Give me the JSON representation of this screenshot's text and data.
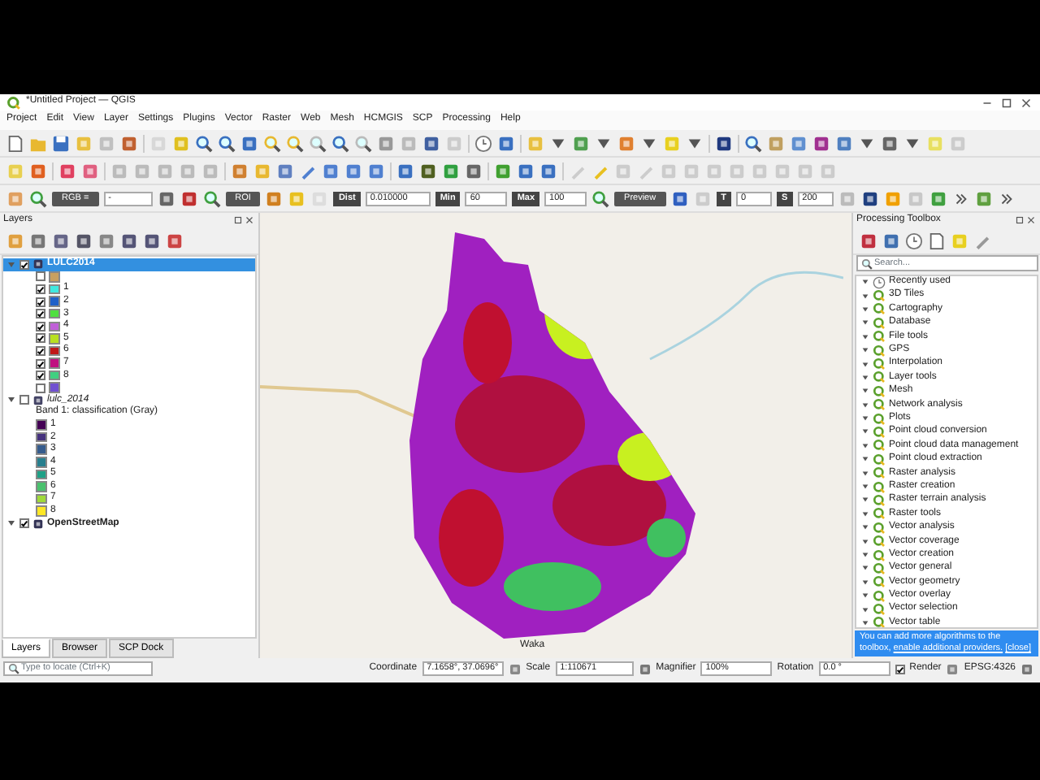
{
  "window": {
    "title": "*Untitled Project — QGIS"
  },
  "menu": [
    "Project",
    "Edit",
    "View",
    "Layer",
    "Settings",
    "Plugins",
    "Vector",
    "Raster",
    "Web",
    "Mesh",
    "HCMGIS",
    "SCP",
    "Processing",
    "Help"
  ],
  "scp_toolbar": {
    "rgb_label": "RGB =",
    "band_value": "-",
    "roi_label": "ROI",
    "fields": [
      {
        "label": "Dist",
        "value": "0.010000"
      },
      {
        "label": "Min",
        "value": "60"
      },
      {
        "label": "Max",
        "value": "100"
      }
    ],
    "preview_label": "Preview",
    "fields_2": [
      {
        "label": "T",
        "value": "0"
      },
      {
        "label": "S",
        "value": "200"
      }
    ]
  },
  "layers_panel": {
    "title": "Layers",
    "layers": [
      {
        "name": "LULC2014",
        "italic": false,
        "checked": true,
        "selected": true,
        "legend": [
          {
            "color": "#c8a060",
            "checked": false
          },
          {
            "label": "1",
            "color": "#40e8e0",
            "checked": true
          },
          {
            "label": "2",
            "color": "#2060c8",
            "checked": true
          },
          {
            "label": "3",
            "color": "#50e040",
            "checked": true
          },
          {
            "label": "4",
            "color": "#c060d8",
            "checked": true
          },
          {
            "label": "5",
            "color": "#b8e020",
            "checked": true
          },
          {
            "label": "6",
            "color": "#c01818",
            "checked": true
          },
          {
            "label": "7",
            "color": "#c01080",
            "checked": true
          },
          {
            "label": "8",
            "color": "#40d080",
            "checked": true
          },
          {
            "color": "#7050d0",
            "checked": false
          }
        ]
      },
      {
        "name": "lulc_2014",
        "italic": true,
        "checked": false,
        "selected": false,
        "subtitle": "Band 1: classification (Gray)",
        "legend": [
          {
            "label": "1",
            "color": "#440154"
          },
          {
            "label": "2",
            "color": "#46327e"
          },
          {
            "label": "3",
            "color": "#365c8d"
          },
          {
            "label": "4",
            "color": "#277f8e"
          },
          {
            "label": "5",
            "color": "#1fa187"
          },
          {
            "label": "6",
            "color": "#4ac16d"
          },
          {
            "label": "7",
            "color": "#a0da39"
          },
          {
            "label": "8",
            "color": "#fde725"
          }
        ]
      },
      {
        "name": "OpenStreetMap",
        "italic": false,
        "checked": true,
        "selected": false
      }
    ],
    "tabs": [
      {
        "label": "Layers",
        "selected": true
      },
      {
        "label": "Browser",
        "selected": false
      },
      {
        "label": "SCP Dock",
        "selected": false
      }
    ],
    "locate": {
      "placeholder": "Type to locate (Ctrl+K)"
    }
  },
  "map": {
    "place_label": "Waka"
  },
  "processing_toolbox": {
    "title": "Processing Toolbox",
    "search": {
      "placeholder": "Search..."
    },
    "items": [
      {
        "label": "Recently used",
        "kind": "recent"
      },
      {
        "label": "3D Tiles",
        "kind": "provider"
      },
      {
        "label": "Cartography",
        "kind": "provider"
      },
      {
        "label": "Database",
        "kind": "provider"
      },
      {
        "label": "File tools",
        "kind": "provider"
      },
      {
        "label": "GPS",
        "kind": "provider"
      },
      {
        "label": "Interpolation",
        "kind": "provider"
      },
      {
        "label": "Layer tools",
        "kind": "provider"
      },
      {
        "label": "Mesh",
        "kind": "provider"
      },
      {
        "label": "Network analysis",
        "kind": "provider"
      },
      {
        "label": "Plots",
        "kind": "provider"
      },
      {
        "label": "Point cloud conversion",
        "kind": "provider"
      },
      {
        "label": "Point cloud data management",
        "kind": "provider"
      },
      {
        "label": "Point cloud extraction",
        "kind": "provider"
      },
      {
        "label": "Raster analysis",
        "kind": "provider"
      },
      {
        "label": "Raster creation",
        "kind": "provider"
      },
      {
        "label": "Raster terrain analysis",
        "kind": "provider"
      },
      {
        "label": "Raster tools",
        "kind": "provider"
      },
      {
        "label": "Vector analysis",
        "kind": "provider"
      },
      {
        "label": "Vector coverage",
        "kind": "provider"
      },
      {
        "label": "Vector creation",
        "kind": "provider"
      },
      {
        "label": "Vector general",
        "kind": "provider"
      },
      {
        "label": "Vector geometry",
        "kind": "provider"
      },
      {
        "label": "Vector overlay",
        "kind": "provider"
      },
      {
        "label": "Vector selection",
        "kind": "provider"
      },
      {
        "label": "Vector table",
        "kind": "provider"
      }
    ],
    "banner": {
      "text": "You can add more algorithms to the toolbox,",
      "link": "enable additional providers.",
      "close": "[close]"
    }
  },
  "status_bar": {
    "coordinate_label": "Coordinate",
    "coordinate": "7.1658°, 37.0696°",
    "scale_label": "Scale",
    "scale": "1:110671",
    "magnifier_label": "Magnifier",
    "magnifier": "100%",
    "rotation_label": "Rotation",
    "rotation": "0.0 °",
    "render_label": "Render",
    "render_checked": true,
    "crs": "EPSG:4326"
  }
}
